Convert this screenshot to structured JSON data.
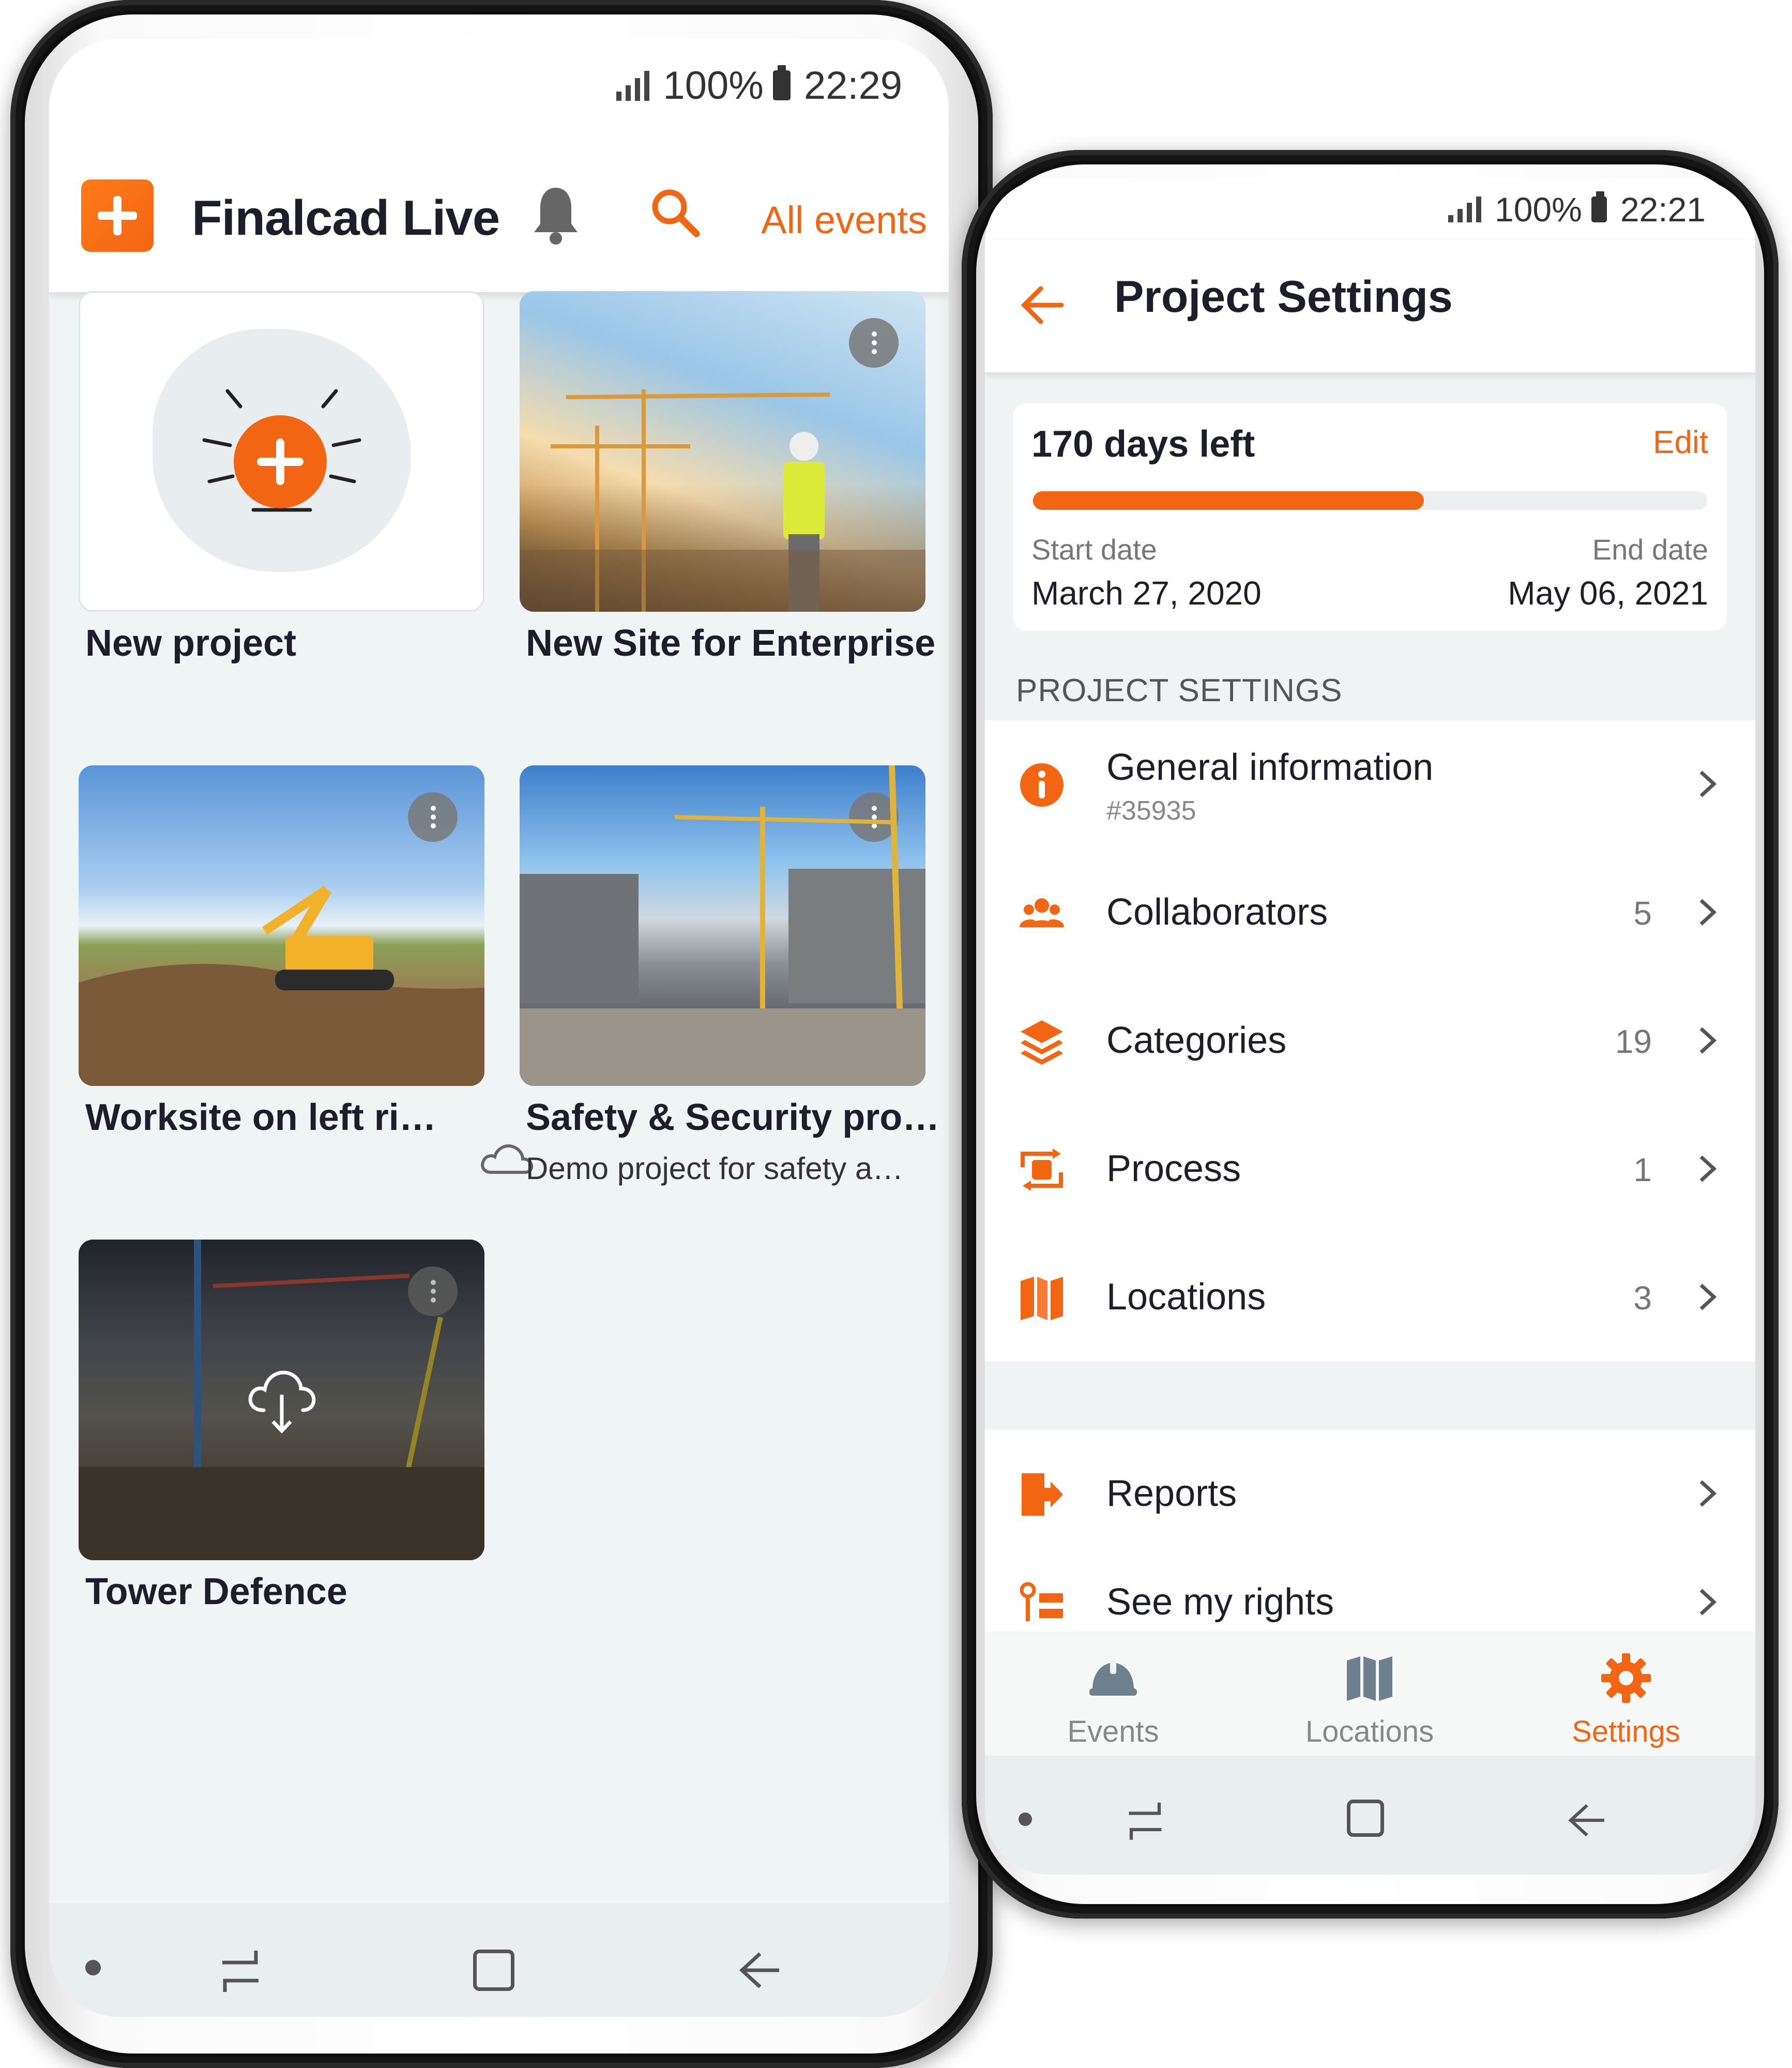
{
  "colors": {
    "accent": "#f26512",
    "text": "#1e1e2a",
    "muted": "#777777",
    "background": "#eff4f5"
  },
  "screen1": {
    "status": {
      "battery": "100%",
      "time": "22:29"
    },
    "header": {
      "title": "Finalcad Live",
      "all_events": "All events"
    },
    "cards": [
      {
        "label": "New project"
      },
      {
        "label": "New Site for Enterprise"
      },
      {
        "label": "Worksite on left ri…"
      },
      {
        "label": "Safety & Security pro…",
        "subtitle": "Demo project for safety a…"
      },
      {
        "label": "Tower Defence"
      }
    ]
  },
  "screen2": {
    "status": {
      "battery": "100%",
      "time": "22:21"
    },
    "header": {
      "title": "Project Settings"
    },
    "timeline": {
      "days_left": "170 days left",
      "edit": "Edit",
      "progress": 0.58,
      "start_label": "Start date",
      "start_value": "March 27, 2020",
      "end_label": "End date",
      "end_value": "May 06, 2021"
    },
    "section_title": "PROJECT SETTINGS",
    "items": [
      {
        "label": "General information",
        "sublabel": "#35935",
        "icon": "info-icon"
      },
      {
        "label": "Collaborators",
        "count": "5",
        "icon": "people-icon"
      },
      {
        "label": "Categories",
        "count": "19",
        "icon": "layers-icon"
      },
      {
        "label": "Process",
        "count": "1",
        "icon": "process-icon"
      },
      {
        "label": "Locations",
        "count": "3",
        "icon": "map-icon"
      }
    ],
    "extra_items": [
      {
        "label": "Reports",
        "icon": "report-export-icon"
      },
      {
        "label": "See my rights",
        "icon": "rights-list-icon"
      }
    ],
    "tabs": [
      {
        "label": "Events",
        "icon": "hard-hat-icon"
      },
      {
        "label": "Locations",
        "icon": "map-icon"
      },
      {
        "label": "Settings",
        "icon": "gear-icon"
      }
    ]
  }
}
